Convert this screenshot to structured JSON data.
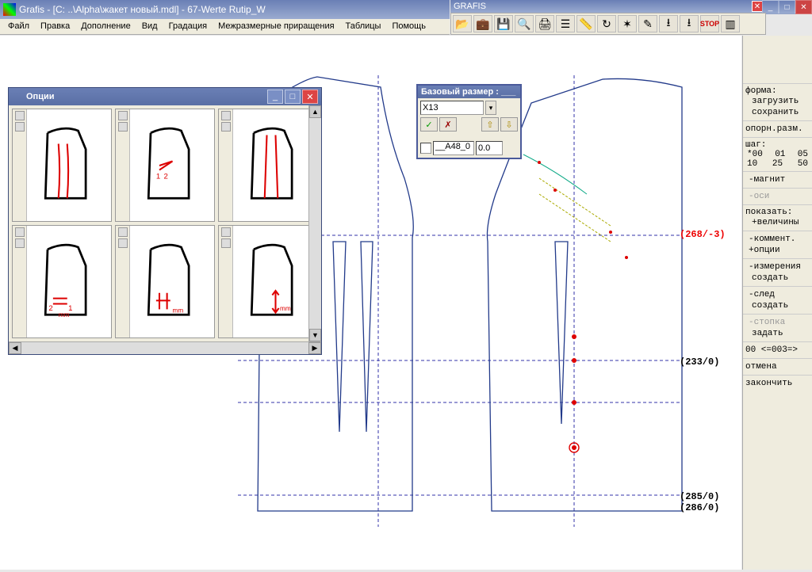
{
  "titlebar": {
    "text": "Grafis - [C: ..\\Alpha\\жакет новый.mdl] - 67-Werte Rutip_W"
  },
  "second_titlebar": {
    "text": "GRAFIS"
  },
  "menu": {
    "items": [
      "Файл",
      "Правка",
      "Дополнение",
      "Вид",
      "Градация",
      "Межразмерные приращения",
      "Таблицы",
      "Помощь"
    ]
  },
  "toolbar": {
    "icons": [
      "open",
      "case",
      "save",
      "zoom",
      "print",
      "stack",
      "ruler",
      "refresh",
      "star",
      "undo",
      "down1",
      "down2",
      "stop",
      "screen"
    ]
  },
  "options_window": {
    "title": "Опции"
  },
  "base_size": {
    "title": "Базовый размер : ___",
    "size_value": "X13",
    "field_name": "__A48_0",
    "field_value": "0.0"
  },
  "side": {
    "shape_label": "форма:",
    "shape_load": "загрузить",
    "shape_save": "сохранить",
    "ref_size": "опорн.разм.",
    "step_label": "шаг:",
    "step_row1": [
      "*00",
      "01",
      "05"
    ],
    "step_row2": [
      "10",
      "25",
      "50"
    ],
    "magnet": "-магнит",
    "axes": "-оси",
    "show_label": "показать:",
    "show_values": "+величины",
    "comment": "-коммент.",
    "options": "+опции",
    "measure": "-измерения",
    "measure_create": "создать",
    "trace": "-след",
    "trace_create": "создать",
    "stack": "-стопка",
    "stack_set": "задать",
    "counter": "00 <=003=>",
    "cancel": "отмена",
    "finish": "закончить"
  },
  "canvas_annotations": {
    "a1": "(268/-3)",
    "a2": "(233/0)",
    "a3": "(285/0)",
    "a4": "(286/0)"
  }
}
